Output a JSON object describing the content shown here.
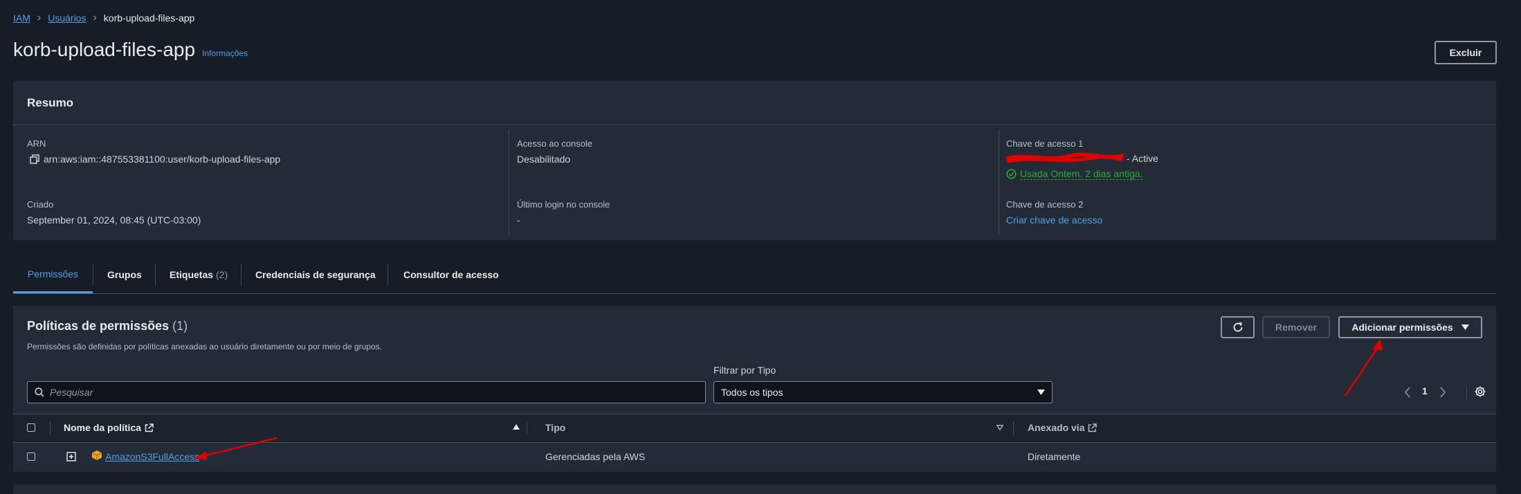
{
  "breadcrumb": {
    "root": "IAM",
    "users": "Usuários",
    "current": "korb-upload-files-app"
  },
  "header": {
    "title": "korb-upload-files-app",
    "info_link": "Informações",
    "delete_button": "Excluir"
  },
  "summary": {
    "title": "Resumo",
    "arn_label": "ARN",
    "arn_value": "arn:aws:iam::487553381100:user/korb-upload-files-app",
    "created_label": "Criado",
    "created_value": "September 01, 2024, 08:45 (UTC-03:00)",
    "console_access_label": "Acesso ao console",
    "console_access_value": "Desabilitado",
    "last_login_label": "Último login no console",
    "last_login_value": "-",
    "access_key1_label": "Chave de acesso 1",
    "access_key1_status": "- Active",
    "access_key1_usage": "Usada Ontem. 2 dias antiga.",
    "access_key2_label": "Chave de acesso 2",
    "access_key2_link": "Criar chave de acesso"
  },
  "tabs": [
    {
      "label": "Permissões"
    },
    {
      "label": "Grupos"
    },
    {
      "label": "Etiquetas",
      "count": "(2)"
    },
    {
      "label": "Credenciais de segurança"
    },
    {
      "label": "Consultor de acesso"
    }
  ],
  "policies": {
    "title": "Políticas de permissões",
    "count": "(1)",
    "description": "Permissões são definidas por políticas anexadas ao usuário diretamente ou por meio de grupos.",
    "remove_button": "Remover",
    "add_button": "Adicionar permissões",
    "search_placeholder": "Pesquisar",
    "filter_label": "Filtrar por Tipo",
    "filter_value": "Todos os tipos",
    "page": "1",
    "columns": {
      "name": "Nome da política",
      "type": "Tipo",
      "attached": "Anexado via"
    },
    "rows": [
      {
        "name": "AmazonS3FullAccess",
        "type": "Gerenciadas pela AWS",
        "attached": "Diretamente"
      }
    ]
  },
  "colors": {
    "background": "#161d26",
    "panel": "#232b37",
    "link": "#539fe5",
    "annotation_arrow": "#e00000",
    "success": "#29ad32"
  },
  "icons": [
    "chevron-right-icon",
    "copy-icon",
    "success-check-icon",
    "refresh-icon",
    "caret-down-icon",
    "search-icon",
    "external-link-icon",
    "sort-up-icon",
    "sort-down-icon",
    "expand-icon",
    "s3-service-icon",
    "settings-gear-icon",
    "chevron-left-icon"
  ]
}
